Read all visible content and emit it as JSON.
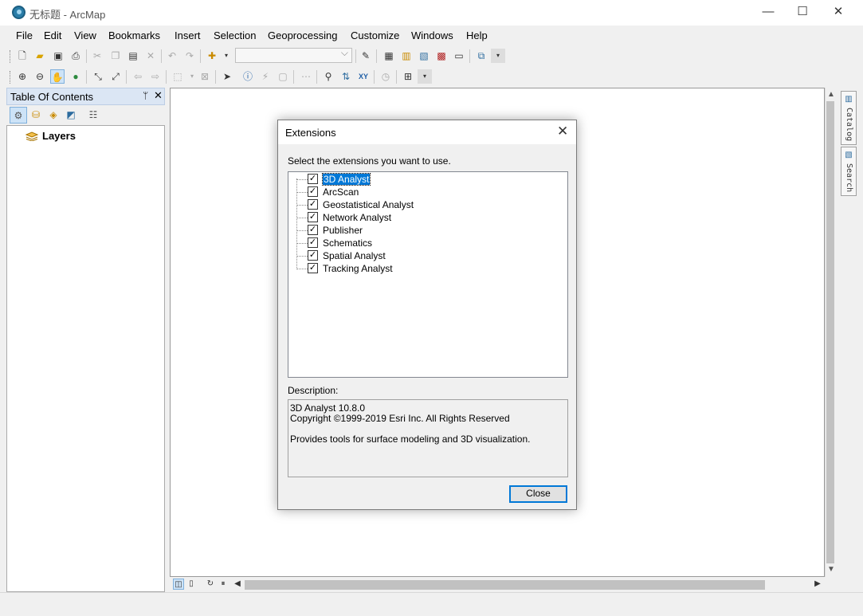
{
  "window": {
    "title": "无标题 - ArcMap",
    "controls": [
      "—",
      "☐",
      "✕"
    ]
  },
  "menubar": {
    "items": [
      "File",
      "Edit",
      "View",
      "Bookmarks",
      "Insert",
      "Selection",
      "Geoprocessing",
      "Customize",
      "Windows",
      "Help"
    ]
  },
  "toolbar": {
    "scale_value": ""
  },
  "toc": {
    "title": "Table Of Contents",
    "pin": "ᛘ",
    "close": "✕",
    "root_label": "Layers"
  },
  "dock": {
    "catalog_label": "Catalog",
    "search_label": "Search"
  },
  "dialog": {
    "title": "Extensions",
    "prompt": "Select the extensions you want to use.",
    "extensions": [
      {
        "label": "3D Analyst",
        "checked": true,
        "selected": true
      },
      {
        "label": "ArcScan",
        "checked": true,
        "selected": false
      },
      {
        "label": "Geostatistical Analyst",
        "checked": true,
        "selected": false
      },
      {
        "label": "Network Analyst",
        "checked": true,
        "selected": false
      },
      {
        "label": "Publisher",
        "checked": true,
        "selected": false
      },
      {
        "label": "Schematics",
        "checked": true,
        "selected": false
      },
      {
        "label": "Spatial Analyst",
        "checked": true,
        "selected": false
      },
      {
        "label": "Tracking Analyst",
        "checked": true,
        "selected": false
      }
    ],
    "description_label": "Description:",
    "description": {
      "line1": "3D Analyst 10.8.0",
      "line2": "Copyright ©1999-2019 Esri Inc. All Rights Reserved",
      "line3": "Provides tools for surface modeling and 3D visualization."
    },
    "close_button": "Close"
  },
  "colors": {
    "selection": "#0078d7",
    "toc_header": "#dbe6f4"
  }
}
